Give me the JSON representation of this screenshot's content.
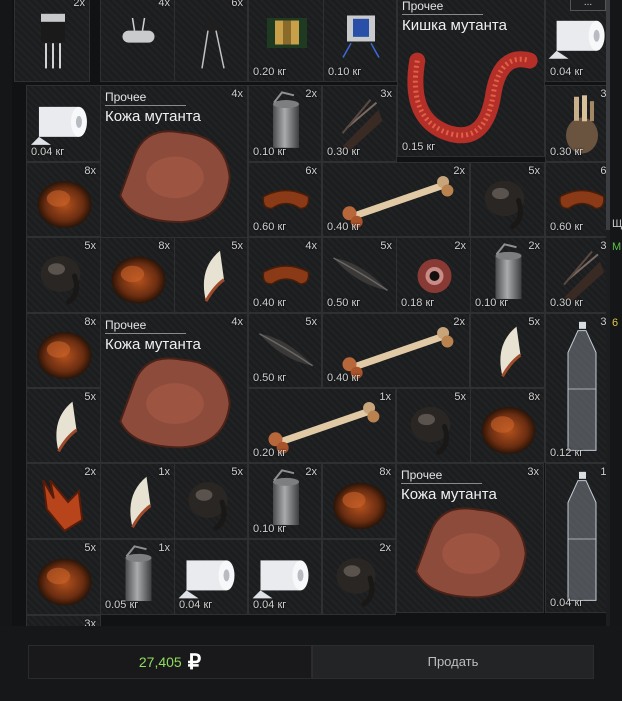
{
  "header": {
    "menu_label": "..."
  },
  "items": [
    {
      "name": "transistor-item",
      "count": "2x",
      "icon": "transistor-icon"
    },
    {
      "name": "crystal-oscillator-item",
      "count": "4x",
      "icon": "crystal-icon"
    },
    {
      "name": "capacitor-item",
      "count": "6x",
      "icon": "capacitor-icon"
    },
    {
      "name": "transformer-coil-item",
      "weight": "0.20 кг",
      "icon": "coil-icon"
    },
    {
      "name": "solenoid-item",
      "weight": "0.10 кг",
      "icon": "solenoid-icon"
    },
    {
      "name": "mutant-gut-item",
      "category": "Прочее",
      "title": "Кишка мутанта",
      "weight": "0.15 кг",
      "icon": "gut-icon"
    },
    {
      "name": "toilet-paper-item",
      "weight": "0.04 кг",
      "icon": "toilet-paper-icon"
    },
    {
      "name": "toilet-paper-item",
      "weight": "0.04 кг",
      "icon": "toilet-paper-icon"
    },
    {
      "name": "mutant-skin-item",
      "category": "Прочее",
      "title": "Кожа мутанта",
      "count": "4x",
      "icon": "skin-icon"
    },
    {
      "name": "tin-can-item",
      "count": "2x",
      "weight": "0.10 кг",
      "icon": "tin-can-icon"
    },
    {
      "name": "mutant-claw-item",
      "count": "3x",
      "weight": "0.30 кг",
      "icon": "claw-hand-icon"
    },
    {
      "name": "mutant-paw-item",
      "count": "3x",
      "weight": "0.30 кг",
      "icon": "paw-icon"
    },
    {
      "name": "fur-item",
      "count": "8x",
      "icon": "fur-icon"
    },
    {
      "name": "sausage-item",
      "count": "6x",
      "weight": "0.60 кг",
      "icon": "sausage-icon"
    },
    {
      "name": "bone-item",
      "count": "2x",
      "weight": "0.40 кг",
      "icon": "bone-icon"
    },
    {
      "name": "hoof-item",
      "count": "5x",
      "icon": "hoof-icon"
    },
    {
      "name": "sausage-item",
      "count": "6x",
      "weight": "0.60 кг",
      "icon": "sausage-icon"
    },
    {
      "name": "hoof-item",
      "count": "5x",
      "icon": "hoof-icon"
    },
    {
      "name": "fur-item",
      "count": "8x",
      "icon": "fur-icon"
    },
    {
      "name": "fang-item",
      "count": "5x",
      "icon": "fang-icon"
    },
    {
      "name": "sausage-item",
      "count": "4x",
      "weight": "0.40 кг",
      "icon": "sausage-icon"
    },
    {
      "name": "feather-item",
      "count": "5x",
      "weight": "0.50 кг",
      "icon": "feather-icon"
    },
    {
      "name": "mutant-eye-item",
      "count": "2x",
      "weight": "0.18 кг",
      "icon": "eye-icon"
    },
    {
      "name": "tin-can-item",
      "count": "2x",
      "weight": "0.10 кг",
      "icon": "tin-can-icon"
    },
    {
      "name": "mutant-claw-item",
      "count": "3x",
      "weight": "0.30 кг",
      "icon": "claw-hand-icon"
    },
    {
      "name": "fur-item",
      "count": "8x",
      "icon": "fur-icon"
    },
    {
      "name": "mutant-skin-item",
      "category": "Прочее",
      "title": "Кожа мутанта",
      "count": "4x",
      "icon": "skin-icon"
    },
    {
      "name": "feather-item",
      "count": "5x",
      "weight": "0.50 кг",
      "icon": "feather-icon"
    },
    {
      "name": "bone-item",
      "count": "2x",
      "weight": "0.40 кг",
      "icon": "bone-icon"
    },
    {
      "name": "fang-item",
      "count": "5x",
      "icon": "fang-icon"
    },
    {
      "name": "plastic-bottle-item",
      "count": "3x",
      "weight": "0.12 кг",
      "icon": "bottle-icon"
    },
    {
      "name": "fang-item",
      "count": "5x",
      "icon": "fang-icon"
    },
    {
      "name": "bone-item",
      "count": "1x",
      "weight": "0.20 кг",
      "icon": "bone-icon"
    },
    {
      "name": "hoof-item",
      "count": "5x",
      "icon": "hoof-icon"
    },
    {
      "name": "fur-item",
      "count": "8x",
      "icon": "fur-icon"
    },
    {
      "name": "burnt-fur-item",
      "count": "2x",
      "icon": "burnt-fur-icon"
    },
    {
      "name": "fang-item",
      "count": "1x",
      "icon": "fang-icon"
    },
    {
      "name": "hoof-item",
      "count": "5x",
      "icon": "hoof-icon"
    },
    {
      "name": "tin-can-item",
      "count": "2x",
      "weight": "0.10 кг",
      "icon": "tin-can-icon"
    },
    {
      "name": "fur-item",
      "count": "8x",
      "icon": "fur-icon"
    },
    {
      "name": "mutant-skin-item",
      "category": "Прочее",
      "title": "Кожа мутанта",
      "count": "3x",
      "icon": "skin-icon"
    },
    {
      "name": "plastic-bottle-item",
      "count": "1x",
      "weight": "0.04 кг",
      "icon": "bottle-icon"
    },
    {
      "name": "fur-item",
      "count": "5x",
      "icon": "fur-icon"
    },
    {
      "name": "tin-can-item",
      "count": "1x",
      "weight": "0.05 кг",
      "icon": "tin-can-icon"
    },
    {
      "name": "toilet-paper-item",
      "weight": "0.04 кг",
      "icon": "toilet-paper-icon"
    },
    {
      "name": "toilet-paper-item",
      "weight": "0.04 кг",
      "icon": "toilet-paper-icon"
    },
    {
      "name": "hoof-item",
      "count": "2x",
      "icon": "hoof-icon"
    },
    {
      "name": "partial-item",
      "count": "3x",
      "icon": "item-icon"
    }
  ],
  "right_edge": {
    "line1": "Щ",
    "line2": "М",
    "line3": "6"
  },
  "footer": {
    "total_value": "27,405",
    "currency_symbol": "₽",
    "sell_label": "Продать"
  },
  "colors": {
    "accent_green": "#8fdc5e",
    "price_yellow": "#e3c448",
    "cell_border": "#2e3032",
    "background": "#151617"
  }
}
